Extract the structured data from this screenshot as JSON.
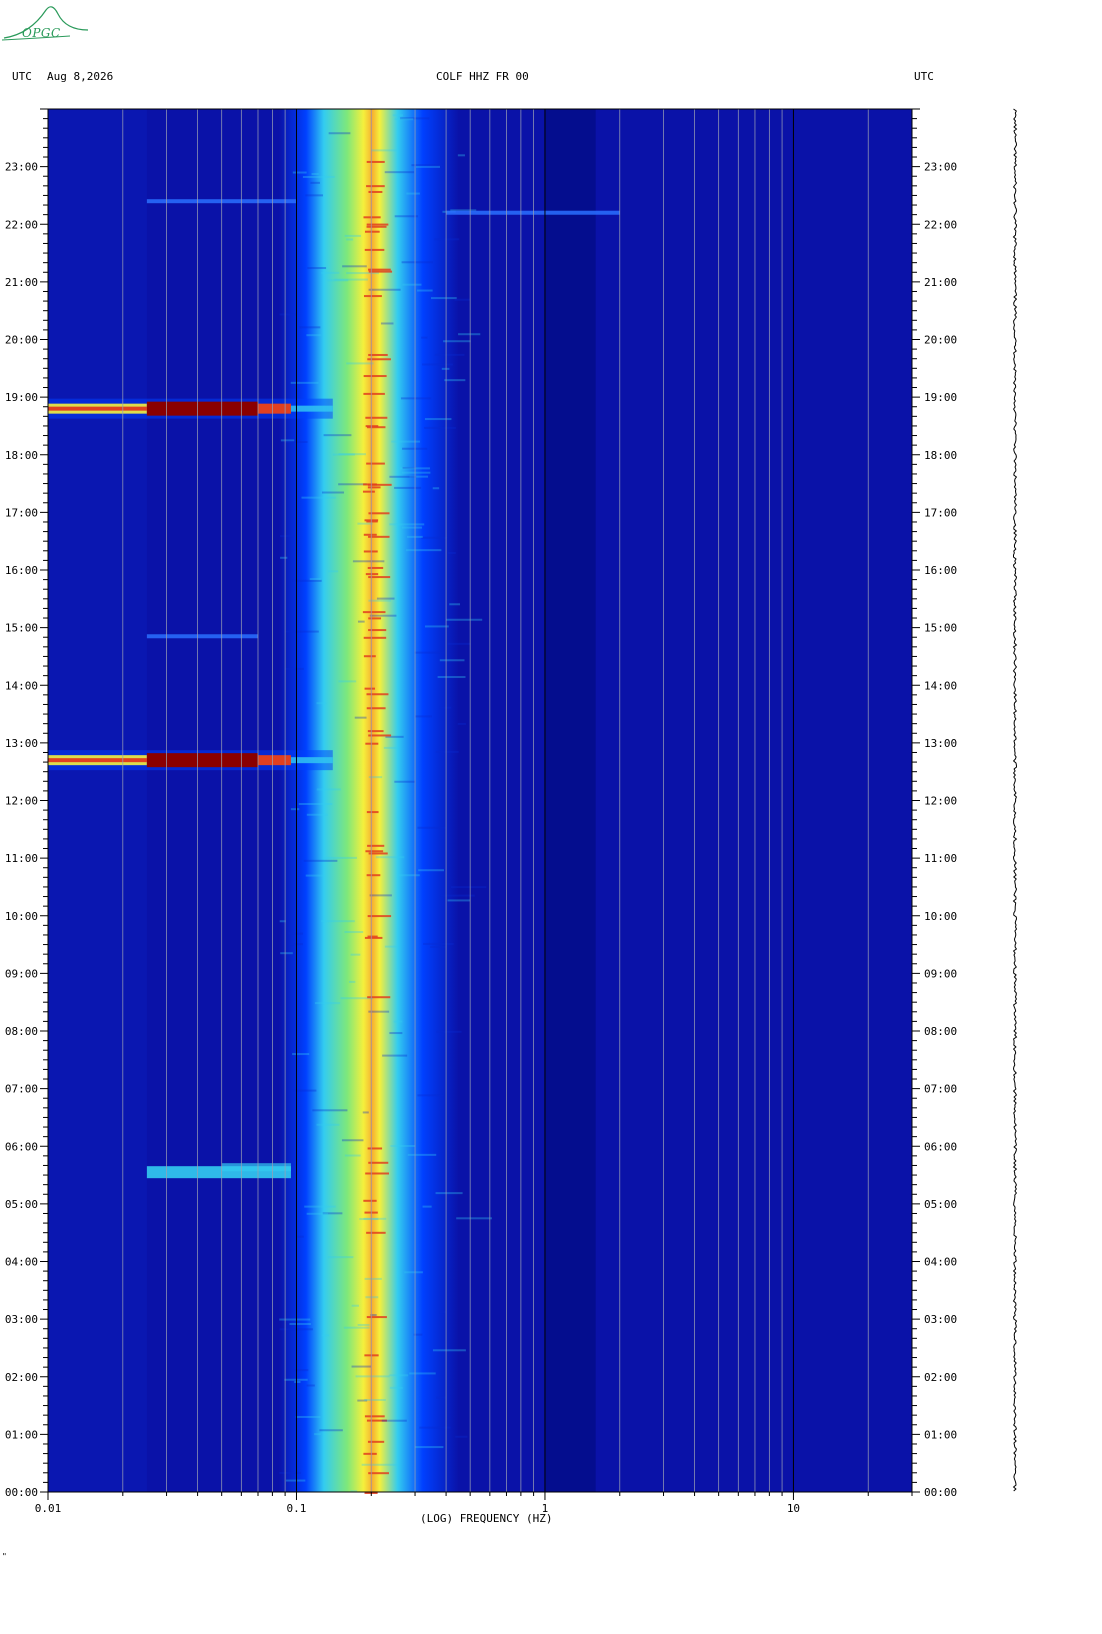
{
  "header": {
    "left_tz": "UTC",
    "date": "Aug 8,2026",
    "station": "COLF HHZ FR 00",
    "right_tz": "UTC"
  },
  "logo": {
    "text": "OPGC",
    "color": "#2a9a5a"
  },
  "footer": {
    "corner_mark": "\""
  },
  "chart_data": {
    "type": "heatmap",
    "xlabel": "(LOG) FREQUENCY (HZ)",
    "x_scale": "log",
    "xlim": [
      0.01,
      30
    ],
    "x_ticks": [
      {
        "value": 0.01,
        "label": "0.01"
      },
      {
        "value": 0.1,
        "label": "0.1"
      },
      {
        "value": 1,
        "label": "1"
      },
      {
        "value": 10,
        "label": "10"
      }
    ],
    "y_unit": "hours UTC",
    "ylim": [
      0,
      24
    ],
    "y_tick_labels": [
      "00:00",
      "01:00",
      "02:00",
      "03:00",
      "04:00",
      "05:00",
      "06:00",
      "07:00",
      "08:00",
      "09:00",
      "10:00",
      "11:00",
      "12:00",
      "13:00",
      "14:00",
      "15:00",
      "16:00",
      "17:00",
      "18:00",
      "19:00",
      "20:00",
      "21:00",
      "22:00",
      "23:00"
    ],
    "colors": {
      "background": "#0a12a8",
      "dark": "#000a78",
      "mid": "#0040ff",
      "cyan": "#33ccf0",
      "yellow": "#f5f03c",
      "red": "#e04020",
      "darkred": "#8a0000"
    },
    "microseism_band": {
      "freq_low": 0.12,
      "freq_high": 0.45,
      "peak_freq": 0.2
    },
    "events": [
      {
        "hour": 18.8,
        "freq_low": 0.01,
        "freq_high": 0.14,
        "level": "strong"
      },
      {
        "hour": 12.7,
        "freq_low": 0.01,
        "freq_high": 0.14,
        "level": "strong"
      },
      {
        "hour": 5.55,
        "freq_low": 0.025,
        "freq_high": 0.095,
        "level": "moderate"
      },
      {
        "hour": 22.4,
        "freq_low": 0.025,
        "freq_high": 0.1,
        "level": "weak"
      },
      {
        "hour": 14.85,
        "freq_low": 0.025,
        "freq_high": 0.07,
        "level": "weak"
      },
      {
        "hour": 22.2,
        "freq_low": 0.4,
        "freq_high": 2.0,
        "level": "weak"
      }
    ]
  }
}
